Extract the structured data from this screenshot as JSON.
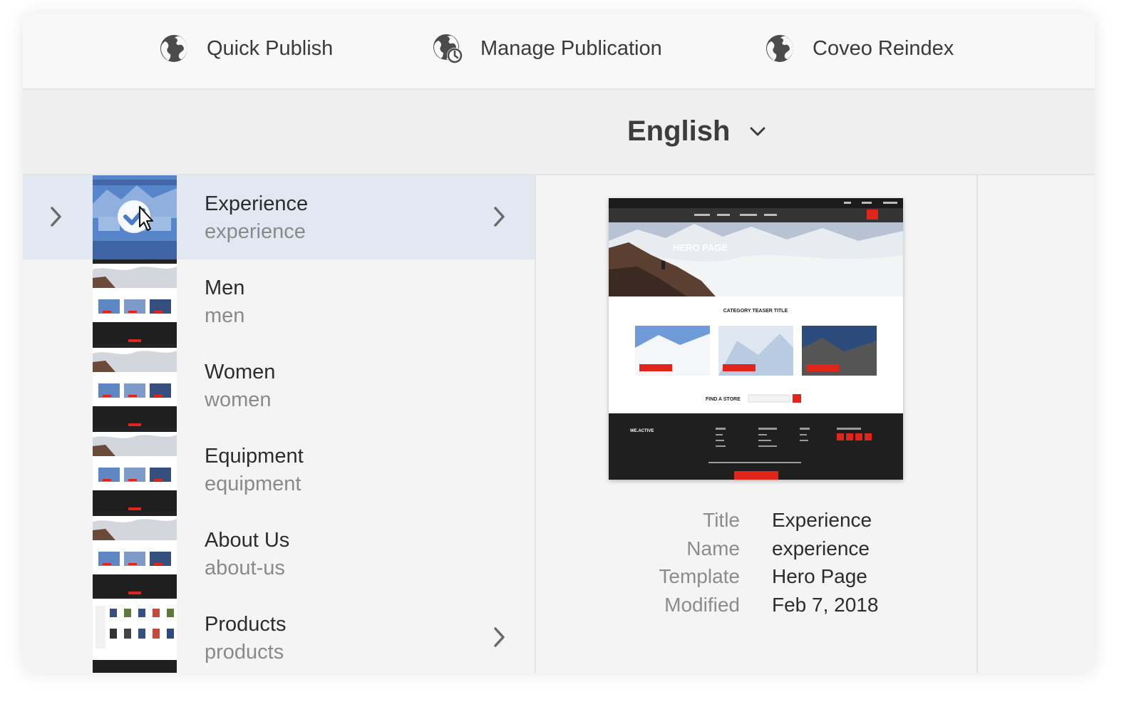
{
  "toolbar": {
    "actions": [
      {
        "label": "Quick Publish",
        "icon": "globe-icon"
      },
      {
        "label": "Manage Publication",
        "icon": "globe-clock-icon"
      },
      {
        "label": "Coveo Reindex",
        "icon": "globe-icon"
      }
    ]
  },
  "language": {
    "selected": "English"
  },
  "pages": [
    {
      "title": "Experience",
      "name": "experience",
      "has_children": true,
      "selected": true
    },
    {
      "title": "Men",
      "name": "men",
      "has_children": false
    },
    {
      "title": "Women",
      "name": "women",
      "has_children": false
    },
    {
      "title": "Equipment",
      "name": "equipment",
      "has_children": false
    },
    {
      "title": "About Us",
      "name": "about-us",
      "has_children": false
    },
    {
      "title": "Products",
      "name": "products",
      "has_children": true
    }
  ],
  "preview": {
    "hero_title": "HERO PAGE",
    "teaser_title": "CATEGORY TEASER TITLE",
    "store_label": "FIND A STORE",
    "brand": "WE.ACTIVE"
  },
  "details": {
    "labels": {
      "title": "Title",
      "name": "Name",
      "template": "Template",
      "modified": "Modified"
    },
    "values": {
      "title": "Experience",
      "name": "experience",
      "template": "Hero Page",
      "modified": "Feb 7, 2018"
    }
  },
  "colors": {
    "accent_red": "#e1251b",
    "selection": "#e2e8f2"
  }
}
